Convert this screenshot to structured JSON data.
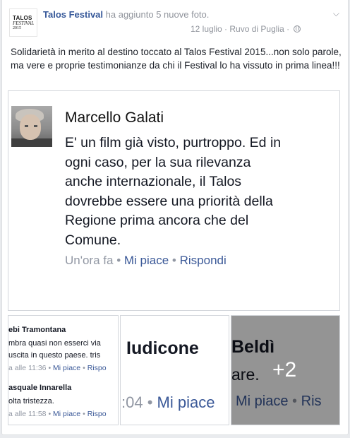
{
  "post": {
    "avatar_logo": {
      "line1": "TALOS",
      "line2": "FESTIVAL",
      "line3": "2015"
    },
    "author": "Talos Festival",
    "action": "ha aggiunto 5 nuove foto.",
    "date": "12 luglio",
    "separator": "·",
    "location": "Ruvo di Puglia",
    "privacy_icon": "globe-icon",
    "menu_icon": "chevron-down-icon",
    "text": "Solidarietà in merito al destino toccato al Talos Festival 2015...non solo parole, ma vere e proprie testimonianze da chi il Festival lo ha vissuto in prima linea!!!"
  },
  "main_photo": {
    "commenter": "Marcello Galati",
    "comment_lines": [
      "E' un film già visto, purtroppo. Ed in",
      "ogni caso, per la sua rilevanza",
      "anche internazionale, il Talos",
      "dovrebbe essere una priorità della",
      "Regione prima ancora che del",
      "Comune."
    ],
    "time": "Un'ora fa",
    "dot": "•",
    "like": "Mi piace",
    "reply": "Rispondi"
  },
  "thumb1": {
    "name1": "ebi Tramontana",
    "text1a": "mbra quasi non esserci via",
    "text1b": "uscita in questo paese. tris",
    "time1": "a alle 11:36",
    "name2": "asquale Innarella",
    "text2": "olta tristezza.",
    "time2": "a alle 11:58",
    "dot": "•",
    "like": "Mi piace",
    "reply": "Rispo"
  },
  "thumb2": {
    "name": "Iudicone",
    "time": ":04",
    "dot": "•",
    "like": "Mi piace"
  },
  "thumb3": {
    "name": "Beldì",
    "text": "are.",
    "like": "Mi piace",
    "dot": "•",
    "reply": "Ris",
    "more_count": "+2"
  }
}
